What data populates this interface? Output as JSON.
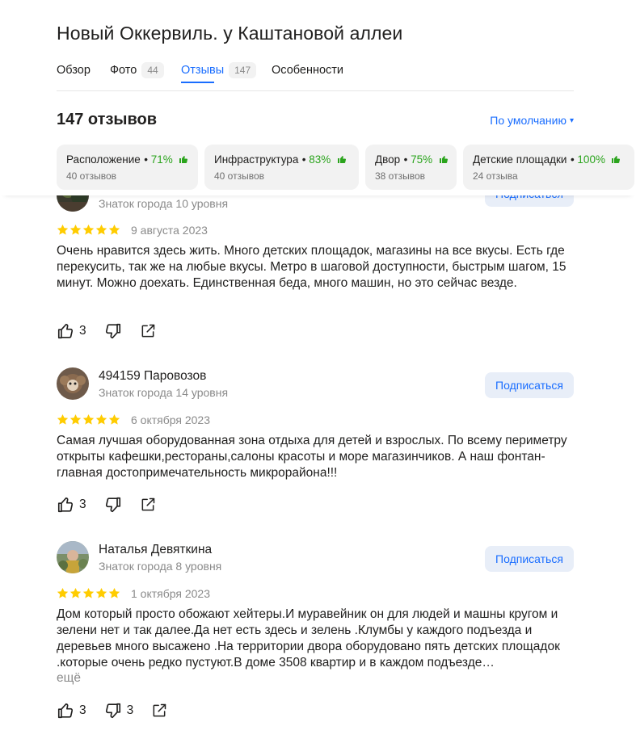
{
  "header": {
    "title": "Новый Оккервиль. у Каштановой аллеи"
  },
  "tabs": [
    {
      "label": "Обзор",
      "count": ""
    },
    {
      "label": "Фото",
      "count": "44"
    },
    {
      "label": "Отзывы",
      "count": "147"
    },
    {
      "label": "Особенности",
      "count": ""
    }
  ],
  "reviews_header": {
    "count_title": "147 отзывов",
    "sort_label": "По умолчанию",
    "sort_arrow": "▾"
  },
  "aspects": [
    {
      "name": "Расположение",
      "percent": "71%",
      "sub": "40 отзывов"
    },
    {
      "name": "Инфраструктура",
      "percent": "83%",
      "sub": "40 отзывов"
    },
    {
      "name": "Двор",
      "percent": "75%",
      "sub": "38 отзывов"
    },
    {
      "name": "Детские площадки",
      "percent": "100%",
      "sub": "24 отзыва"
    }
  ],
  "colors": {
    "accent": "#196dff",
    "positive": "#2ba41d",
    "star": "#fc0"
  },
  "reviews": [
    {
      "author": "",
      "level": "Знаток города 10 уровня",
      "subscribe_label": "Подписаться",
      "rating": 5,
      "date": "9 августа 2023",
      "text": "Очень нравится здесь жить. Много детских площадок, магазины на все вкусы. Есть где перекусить, так же на любые вкусы. Метро в шаговой доступности, быстрым шагом, 15 минут. Можно доехать. Единственная беда, много машин, но это сейчас везде.",
      "likes": "3",
      "dislikes": ""
    },
    {
      "author": "494159 Паровозов",
      "level": "Знаток города 14 уровня",
      "subscribe_label": "Подписаться",
      "rating": 5,
      "date": "6 октября 2023",
      "text": "Самая лучшая оборудованная зона отдыха для детей и взрослых. По всему периметру открыты кафешки,рестораны,салоны красоты и море магазинчиков. А наш фонтан-главная достопримечательность микрорайона!!!",
      "likes": "3",
      "dislikes": ""
    },
    {
      "author": "Наталья Девяткина",
      "level": "Знаток города 8 уровня",
      "subscribe_label": "Подписаться",
      "rating": 5,
      "date": "1 октября 2023",
      "text": "Дом который просто обожают хейтеры.И муравейник он для людей и машны кругом и зелени нет и так далее.Да нет есть здесь и зелень .Клумбы у каждого подъезда и деревьев много высажено .На территории двора оборудовано пять детских площадок .которые очень редко пустуют.В доме 3508 квартир и в каждом подъезде…",
      "more_label": "ещё",
      "likes": "3",
      "dislikes": "3"
    }
  ]
}
